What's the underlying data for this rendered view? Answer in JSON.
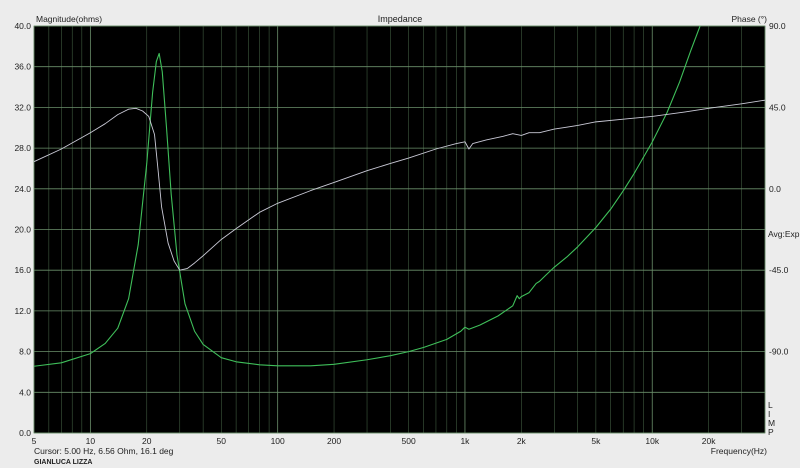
{
  "chart_data": {
    "type": "line",
    "title": "Impedance",
    "xlabel": "Frequency(Hz)",
    "ylabel_left": "Magnitude(ohms)",
    "ylabel_right": "Phase (°)",
    "x_scale": "log",
    "xlim": [
      5,
      40000
    ],
    "ylim_left": [
      0,
      40
    ],
    "ylim_right": [
      -135,
      90
    ],
    "grid": true,
    "background": "#000000",
    "x_ticks": [
      {
        "value": 5,
        "label": "5"
      },
      {
        "value": 10,
        "label": "10"
      },
      {
        "value": 20,
        "label": "20"
      },
      {
        "value": 50,
        "label": "50"
      },
      {
        "value": 100,
        "label": "100"
      },
      {
        "value": 200,
        "label": "200"
      },
      {
        "value": 500,
        "label": "500"
      },
      {
        "value": 1000,
        "label": "1k"
      },
      {
        "value": 2000,
        "label": "2k"
      },
      {
        "value": 5000,
        "label": "5k"
      },
      {
        "value": 10000,
        "label": "10k"
      },
      {
        "value": 20000,
        "label": "20k"
      }
    ],
    "y_ticks_left": [
      "0.0",
      "4.0",
      "8.0",
      "12.0",
      "16.0",
      "20.0",
      "24.0",
      "28.0",
      "32.0",
      "36.0",
      "40.0"
    ],
    "y_ticks_right": [
      "90.0",
      "45.0",
      "0.0",
      "-45.0",
      "-90.0"
    ],
    "right_annotation": "Avg:Exp",
    "right_letters": [
      "L",
      "I",
      "M",
      "P"
    ],
    "series": [
      {
        "role": "magnitude",
        "color": "#3fbf5a",
        "axis": "left",
        "points": [
          [
            5,
            6.56
          ],
          [
            7,
            6.9
          ],
          [
            10,
            7.8
          ],
          [
            12,
            8.8
          ],
          [
            14,
            10.3
          ],
          [
            16,
            13.2
          ],
          [
            18,
            18.5
          ],
          [
            20,
            26.5
          ],
          [
            21.5,
            33.5
          ],
          [
            22.5,
            36.5
          ],
          [
            23.3,
            37.3
          ],
          [
            24.2,
            35.5
          ],
          [
            25.5,
            30
          ],
          [
            27,
            23.5
          ],
          [
            29,
            17.5
          ],
          [
            32,
            12.7
          ],
          [
            36,
            10.0
          ],
          [
            40,
            8.7
          ],
          [
            50,
            7.4
          ],
          [
            60,
            7.0
          ],
          [
            80,
            6.7
          ],
          [
            100,
            6.6
          ],
          [
            150,
            6.6
          ],
          [
            200,
            6.75
          ],
          [
            300,
            7.2
          ],
          [
            400,
            7.6
          ],
          [
            500,
            8.0
          ],
          [
            600,
            8.4
          ],
          [
            800,
            9.2
          ],
          [
            950,
            10.0
          ],
          [
            1000,
            10.4
          ],
          [
            1050,
            10.2
          ],
          [
            1200,
            10.6
          ],
          [
            1500,
            11.5
          ],
          [
            1800,
            12.5
          ],
          [
            1900,
            13.5
          ],
          [
            1950,
            13.2
          ],
          [
            2000,
            13.4
          ],
          [
            2200,
            13.8
          ],
          [
            2400,
            14.7
          ],
          [
            2500,
            14.9
          ],
          [
            2700,
            15.5
          ],
          [
            3000,
            16.3
          ],
          [
            3500,
            17.3
          ],
          [
            4000,
            18.3
          ],
          [
            5000,
            20.2
          ],
          [
            6000,
            22.0
          ],
          [
            7000,
            23.8
          ],
          [
            8000,
            25.5
          ],
          [
            10000,
            28.6
          ],
          [
            12000,
            31.5
          ],
          [
            14000,
            34.5
          ],
          [
            16000,
            37.5
          ],
          [
            18000,
            40.0
          ]
        ]
      },
      {
        "role": "phase",
        "color": "#c9c9d6",
        "axis": "right",
        "points": [
          [
            5,
            15
          ],
          [
            7,
            22
          ],
          [
            10,
            31
          ],
          [
            12,
            36
          ],
          [
            14,
            41
          ],
          [
            16,
            44
          ],
          [
            17.5,
            44.5
          ],
          [
            19,
            43
          ],
          [
            20.5,
            40
          ],
          [
            22,
            30
          ],
          [
            23,
            10
          ],
          [
            24,
            -10
          ],
          [
            26,
            -30
          ],
          [
            28,
            -40
          ],
          [
            30,
            -45
          ],
          [
            33,
            -44
          ],
          [
            36,
            -41
          ],
          [
            40,
            -37
          ],
          [
            50,
            -28
          ],
          [
            60,
            -22
          ],
          [
            80,
            -13
          ],
          [
            100,
            -8
          ],
          [
            150,
            -1
          ],
          [
            200,
            3.5
          ],
          [
            300,
            10
          ],
          [
            400,
            14
          ],
          [
            500,
            17
          ],
          [
            700,
            22
          ],
          [
            900,
            25
          ],
          [
            1000,
            26
          ],
          [
            1050,
            22
          ],
          [
            1100,
            25
          ],
          [
            1300,
            27
          ],
          [
            1600,
            29
          ],
          [
            1800,
            30.5
          ],
          [
            2000,
            29.5
          ],
          [
            2200,
            31
          ],
          [
            2500,
            31
          ],
          [
            3000,
            33
          ],
          [
            4000,
            35
          ],
          [
            5000,
            37
          ],
          [
            7000,
            38.5
          ],
          [
            10000,
            40
          ],
          [
            15000,
            42.5
          ],
          [
            20000,
            44.5
          ],
          [
            30000,
            47
          ],
          [
            40000,
            49
          ]
        ]
      }
    ]
  },
  "status": {
    "cursor": "Cursor: 5.00 Hz, 6.56 Ohm, 16.1 deg",
    "credit": "GIANLUCA LIZZA"
  }
}
